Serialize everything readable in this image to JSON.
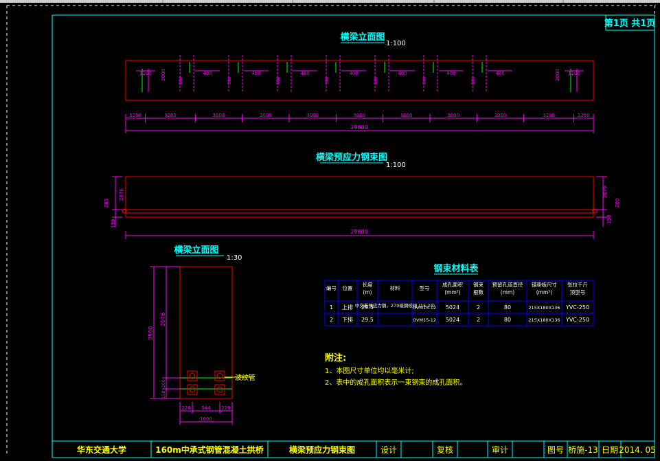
{
  "sheet": {
    "page_label": "第1页 共1页"
  },
  "elevation": {
    "title": "横梁立面图",
    "scale": "1:100",
    "top_dims": [
      "1100",
      "2000",
      "500",
      "400",
      "500",
      "400",
      "500",
      "400",
      "500",
      "400",
      "500",
      "400",
      "500",
      "400",
      "500",
      "400",
      "2000",
      "1100"
    ],
    "bottom_dims": [
      "1250",
      "3200",
      "3000",
      "3000",
      "3000",
      "3000",
      "3000",
      "3000",
      "3000",
      "3200",
      "1250"
    ],
    "overall": "29600"
  },
  "tendon": {
    "title": "横梁预应力钢束图",
    "scale": "1:100",
    "left_dims": [
      "2076",
      "285",
      "158"
    ],
    "right_dims": [
      "2076",
      "200",
      "158"
    ],
    "overall": "29600"
  },
  "section": {
    "title": "横梁立面图",
    "scale": "1:30",
    "height_total": "2500",
    "height_upper": "2076",
    "height_mid": "200",
    "height_low": "158",
    "width_dims": [
      "228",
      "544",
      "228"
    ],
    "width_total": "1000",
    "callout": "波纹管"
  },
  "materials": {
    "title": "钢束材料表",
    "headers": [
      "编号",
      "位置",
      "长度 (m)",
      "材料",
      "型号",
      "成孔面积 (mm²)",
      "钢束 根数",
      "预留孔道直径 (mm)",
      "锚垫板尺寸 (mm³)",
      "张拉千斤 顶型号"
    ],
    "rows": [
      [
        "1",
        "上排",
        "29.5",
        "中交新预应力钢，270级钢绞线 (15.24)",
        "OVM15-12",
        "5024",
        "2",
        "80",
        "215X180X136",
        "YVC-250"
      ],
      [
        "2",
        "下排",
        "29.5",
        "",
        "OVM15-12",
        "5024",
        "2",
        "80",
        "215X180X136",
        "YVC-250"
      ]
    ]
  },
  "notes": {
    "heading": "附注:",
    "lines": [
      "1、本图尺寸单位均以毫米计;",
      "2、表中的成孔面积表示一束钢束的成孔面积。"
    ]
  },
  "titleblock": {
    "school": "华东交通大学",
    "project": "160m中承式钢管混凝土拱桥",
    "drawing": "横梁预应力钢束图",
    "design": "设计",
    "review": "复核",
    "audit": "审计",
    "drawing_no_label": "图号",
    "drawing_no": "桥施-13",
    "date_label": "日期",
    "date": "2014. 05"
  }
}
